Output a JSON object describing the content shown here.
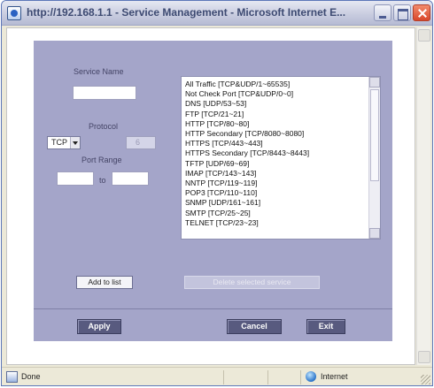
{
  "window": {
    "title": "http://192.168.1.1 - Service Management - Microsoft Internet E..."
  },
  "form": {
    "service_name_label": "Service Name",
    "service_name_value": "",
    "protocol_label": "Protocol",
    "protocol_selected": "TCP",
    "protocol_number_value": "6",
    "port_range_label": "Port Range",
    "port_from_value": "",
    "port_to_label": "to",
    "port_to_value": ""
  },
  "service_list": {
    "items": [
      "All Traffic [TCP&UDP/1~65535]",
      "Not Check Port [TCP&UDP/0~0]",
      "DNS [UDP/53~53]",
      "FTP [TCP/21~21]",
      "HTTP [TCP/80~80]",
      "HTTP Secondary [TCP/8080~8080]",
      "HTTPS [TCP/443~443]",
      "HTTPS Secondary [TCP/8443~8443]",
      "TFTP [UDP/69~69]",
      "IMAP [TCP/143~143]",
      "NNTP [TCP/119~119]",
      "POP3 [TCP/110~110]",
      "SNMP [UDP/161~161]",
      "SMTP [TCP/25~25]",
      "TELNET [TCP/23~23]"
    ]
  },
  "buttons": {
    "add_to_list": "Add to list",
    "delete_selected": "Delete selected service",
    "apply": "Apply",
    "cancel": "Cancel",
    "exit": "Exit"
  },
  "status": {
    "left": "Done",
    "zone": "Internet"
  },
  "colors": {
    "panel": "#a4a5c9",
    "dark_button": "#585a7f"
  }
}
